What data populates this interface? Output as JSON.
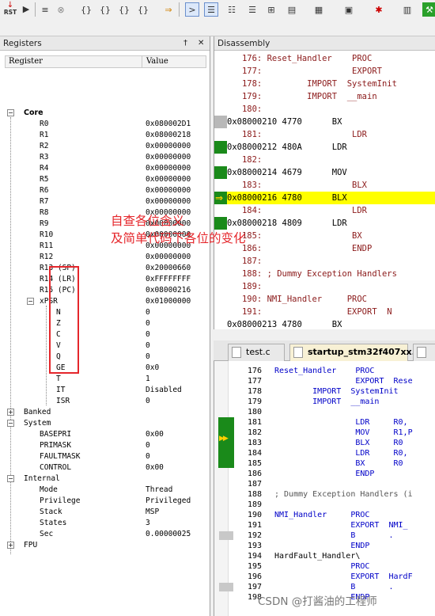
{
  "toolbar": {
    "rst_label": "RST",
    "buttons": [
      "registers-icon",
      "reset-icon",
      "run-icon",
      "stop-icon",
      "step-icon",
      "step-over-icon",
      "step-out-icon",
      "run-to-cursor-icon",
      "show-next-icon",
      "command-window-icon",
      "disassembly-icon",
      "symbols-icon",
      "registers-window-icon",
      "call-stack-icon",
      "watch-icon",
      "memory-icon",
      "serial-icon",
      "analysis-icon",
      "trace-icon",
      "system-viewer-icon",
      "toolbox-icon"
    ]
  },
  "registers": {
    "title": "Registers",
    "pin_icon": "†",
    "close_icon": "✕",
    "col_register": "Register",
    "col_value": "Value",
    "core": {
      "label": "Core",
      "rows": [
        {
          "name": "R0",
          "value": "0x080002D1"
        },
        {
          "name": "R1",
          "value": "0x08000218"
        },
        {
          "name": "R2",
          "value": "0x00000000"
        },
        {
          "name": "R3",
          "value": "0x00000000"
        },
        {
          "name": "R4",
          "value": "0x00000000"
        },
        {
          "name": "R5",
          "value": "0x00000000"
        },
        {
          "name": "R6",
          "value": "0x00000000"
        },
        {
          "name": "R7",
          "value": "0x00000000"
        },
        {
          "name": "R8",
          "value": "0x00000000"
        },
        {
          "name": "R9",
          "value": "0x00000000"
        },
        {
          "name": "R10",
          "value": "0x00000000"
        },
        {
          "name": "R11",
          "value": "0x00000000"
        },
        {
          "name": "R12",
          "value": "0x00000000"
        },
        {
          "name": "R13 (SP)",
          "value": "0x20000660"
        },
        {
          "name": "R14 (LR)",
          "value": "0xFFFFFFFF"
        },
        {
          "name": "R15 (PC)",
          "value": "0x08000216"
        }
      ],
      "xpsr": {
        "name": "xPSR",
        "value": "0x01000000"
      },
      "flags": [
        {
          "name": "N",
          "value": "0"
        },
        {
          "name": "Z",
          "value": "0"
        },
        {
          "name": "C",
          "value": "0"
        },
        {
          "name": "V",
          "value": "0"
        },
        {
          "name": "Q",
          "value": "0"
        },
        {
          "name": "GE",
          "value": "0x0"
        },
        {
          "name": "T",
          "value": "1"
        },
        {
          "name": "IT",
          "value": "Disabled"
        },
        {
          "name": "ISR",
          "value": "0"
        }
      ]
    },
    "banked": {
      "label": "Banked"
    },
    "system": {
      "label": "System",
      "rows": [
        {
          "name": "BASEPRI",
          "value": "0x00"
        },
        {
          "name": "PRIMASK",
          "value": "0"
        },
        {
          "name": "FAULTMASK",
          "value": "0"
        },
        {
          "name": "CONTROL",
          "value": "0x00"
        }
      ]
    },
    "internal": {
      "label": "Internal",
      "rows": [
        {
          "name": "Mode",
          "value": "Thread"
        },
        {
          "name": "Privilege",
          "value": "Privileged"
        },
        {
          "name": "Stack",
          "value": "MSP"
        },
        {
          "name": "States",
          "value": "3"
        },
        {
          "name": "Sec",
          "value": "0.00000025"
        }
      ]
    },
    "fpu": {
      "label": "FPU"
    }
  },
  "disassembly": {
    "title": "Disassembly",
    "rows": [
      {
        "kind": "src",
        "text": "   176: Reset_Handler    PROC"
      },
      {
        "kind": "src",
        "text": "   177:                  EXPORT"
      },
      {
        "kind": "src",
        "text": "   178:         IMPORT  SystemInit"
      },
      {
        "kind": "src",
        "text": "   179:         IMPORT  __main"
      },
      {
        "kind": "src",
        "text": "   180:"
      },
      {
        "kind": "asm",
        "text": "0x08000210 4770      BX",
        "marker": "gray"
      },
      {
        "kind": "src",
        "text": "   181:                  LDR"
      },
      {
        "kind": "asm",
        "text": "0x08000212 480A      LDR",
        "marker": "green"
      },
      {
        "kind": "src",
        "text": "   182:"
      },
      {
        "kind": "asm",
        "text": "0x08000214 4679      MOV",
        "marker": "green"
      },
      {
        "kind": "src",
        "text": "   183:                  BLX"
      },
      {
        "kind": "asm",
        "text": "0x08000216 4780      BLX",
        "marker": "current"
      },
      {
        "kind": "src",
        "text": "   184:                  LDR"
      },
      {
        "kind": "asm",
        "text": "0x08000218 4809      LDR",
        "marker": "green"
      },
      {
        "kind": "src",
        "text": "   185:                  BX"
      },
      {
        "kind": "src",
        "text": "   186:                  ENDP"
      },
      {
        "kind": "src",
        "text": "   187:"
      },
      {
        "kind": "src",
        "text": "   188: ; Dummy Exception Handlers"
      },
      {
        "kind": "src",
        "text": "   189:"
      },
      {
        "kind": "src",
        "text": "   190: NMI_Handler     PROC"
      },
      {
        "kind": "src",
        "text": "   191:                 EXPORT  N"
      },
      {
        "kind": "asm",
        "text": "0x08000213 4780      BX",
        "marker": "none"
      }
    ]
  },
  "editor": {
    "tabs": [
      {
        "label": "test.c",
        "active": false
      },
      {
        "label": "startup_stm32f407xx.s",
        "active": true
      }
    ],
    "lines": [
      {
        "num": "176",
        "code": "Reset_Handler    PROC"
      },
      {
        "num": "177",
        "code": "                 EXPORT  Rese"
      },
      {
        "num": "178",
        "code": "        IMPORT  SystemInit"
      },
      {
        "num": "179",
        "code": "        IMPORT  __main"
      },
      {
        "num": "180",
        "code": ""
      },
      {
        "num": "181",
        "code": "                 LDR     R0,"
      },
      {
        "num": "182",
        "code": "                 MOV     R1,P"
      },
      {
        "num": "183",
        "code": "                 BLX     R0"
      },
      {
        "num": "184",
        "code": "                 LDR     R0,"
      },
      {
        "num": "185",
        "code": "                 BX      R0"
      },
      {
        "num": "186",
        "code": "                 ENDP"
      },
      {
        "num": "187",
        "code": ""
      },
      {
        "num": "188",
        "code": "; Dummy Exception Handlers (i"
      },
      {
        "num": "189",
        "code": ""
      },
      {
        "num": "190",
        "code": "NMI_Handler     PROC"
      },
      {
        "num": "191",
        "code": "                EXPORT  NMI_"
      },
      {
        "num": "192",
        "code": "                B       ."
      },
      {
        "num": "193",
        "code": "                ENDP"
      },
      {
        "num": "194",
        "code": "HardFault_Handler\\"
      },
      {
        "num": "195",
        "code": "                PROC"
      },
      {
        "num": "196",
        "code": "                EXPORT  HardF"
      },
      {
        "num": "197",
        "code": "                B       ."
      },
      {
        "num": "198",
        "code": "                ENDP"
      }
    ]
  },
  "annotation": {
    "line1": "自查各位含义",
    "line2": "及简单代码下各位的变化"
  },
  "watermark": "CSDN @打酱油的工程师",
  "colors": {
    "highlight": "#ffff00",
    "exec_marker": "#1a8a1a",
    "annotation_red": "#e5262b",
    "source_text": "#8b1a1a"
  }
}
